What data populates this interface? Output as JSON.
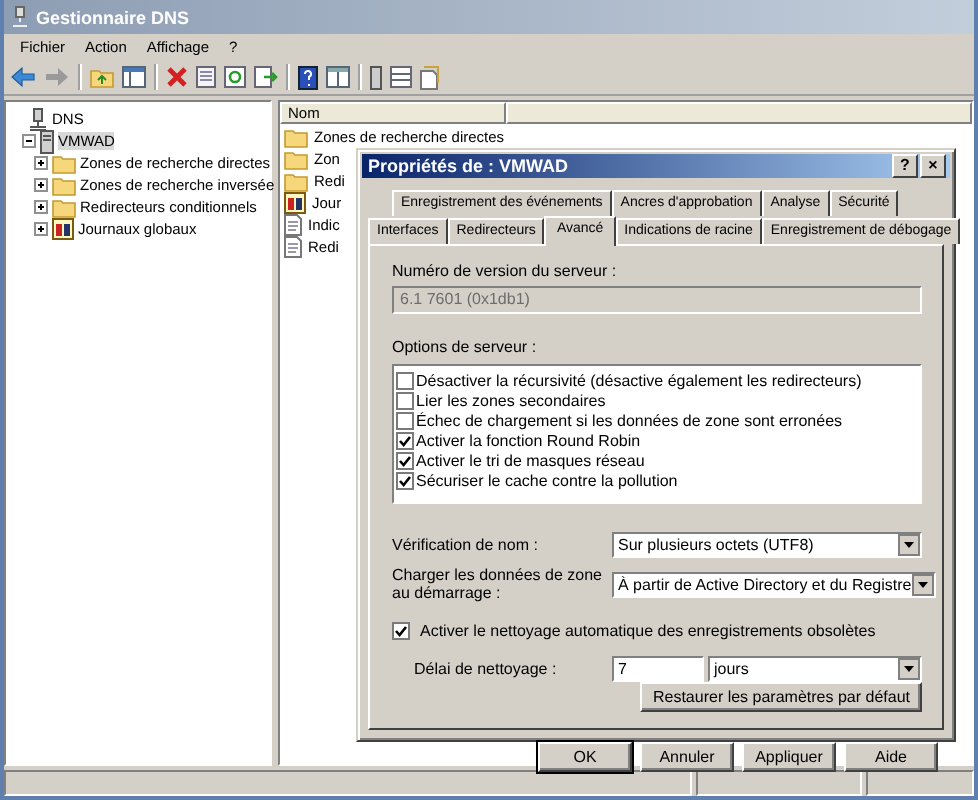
{
  "window": {
    "title": "Gestionnaire DNS"
  },
  "menu": [
    "Fichier",
    "Action",
    "Affichage",
    "?"
  ],
  "tree": [
    {
      "label": "DNS",
      "kind": "dns",
      "selected": false,
      "children": [
        {
          "label": "VMWAD",
          "kind": "server",
          "selected": true,
          "expanded": true,
          "children": [
            {
              "label": "Zones de recherche directes",
              "kind": "folder",
              "selected": false,
              "expanded": false
            },
            {
              "label": "Zones de recherche inversée",
              "kind": "folder",
              "selected": false,
              "expanded": false
            },
            {
              "label": "Redirecteurs conditionnels",
              "kind": "folder",
              "selected": false,
              "expanded": false
            },
            {
              "label": "Journaux globaux",
              "kind": "log",
              "selected": false,
              "expanded": false
            }
          ]
        }
      ]
    }
  ],
  "list": {
    "columns": [
      "Nom"
    ],
    "rows": [
      {
        "label": "Zones de recherche directes",
        "kind": "folder",
        "selected": false
      },
      {
        "label": "Zon",
        "kind": "folder",
        "selected": false
      },
      {
        "label": "Redi",
        "kind": "folder",
        "selected": false
      },
      {
        "label": "Jour",
        "kind": "log",
        "selected": false
      },
      {
        "label": "Indic",
        "kind": "document",
        "selected": false
      },
      {
        "label": "Redi",
        "kind": "document",
        "selected": false
      }
    ]
  },
  "dialog": {
    "title": "Propriétés de : VMWAD",
    "title_buttons": [
      "?",
      "×"
    ],
    "tabs_row_1": [
      {
        "label": "Enregistrement des événements",
        "selected": false
      },
      {
        "label": "Ancres d'approbation",
        "selected": false
      },
      {
        "label": "Analyse",
        "selected": false
      },
      {
        "label": "Sécurité",
        "selected": false
      }
    ],
    "tabs_row_2": [
      {
        "label": "Interfaces",
        "selected": false
      },
      {
        "label": "Redirecteurs",
        "selected": false
      },
      {
        "label": "Avancé",
        "selected": true
      },
      {
        "label": "Indications de racine",
        "selected": false
      },
      {
        "label": "Enregistrement de débogage",
        "selected": false
      }
    ],
    "version_label": "Numéro de version du serveur :",
    "version_value": "6.1 7601 (0x1db1)",
    "options_label": "Options de serveur :",
    "options": [
      {
        "label": "Désactiver la récursivité (désactive également les redirecteurs)",
        "checked": false
      },
      {
        "label": "Lier les zones secondaires",
        "checked": false
      },
      {
        "label": "Échec de chargement si les données de zone sont erronées",
        "checked": false
      },
      {
        "label": "Activer la fonction Round Robin",
        "checked": true
      },
      {
        "label": "Activer le tri de masques réseau",
        "checked": true
      },
      {
        "label": "Sécuriser le cache contre la pollution",
        "checked": true
      }
    ],
    "name_check": {
      "label": "Vérification de nom :",
      "value": "Sur plusieurs octets (UTF8)"
    },
    "load_zone": {
      "label": "Charger les données de zone au démarrage :",
      "value": "À partir de Active Directory et du Registre"
    },
    "scavenging": {
      "label": "Activer le nettoyage automatique des enregistrements obsolètes",
      "checked": true
    },
    "scavenging_period": {
      "label": "Délai de nettoyage :",
      "value": "7",
      "unit": "jours"
    },
    "reset_button": "Restaurer les paramètres par défaut",
    "buttons": [
      "OK",
      "Annuler",
      "Appliquer",
      "Aide"
    ]
  }
}
